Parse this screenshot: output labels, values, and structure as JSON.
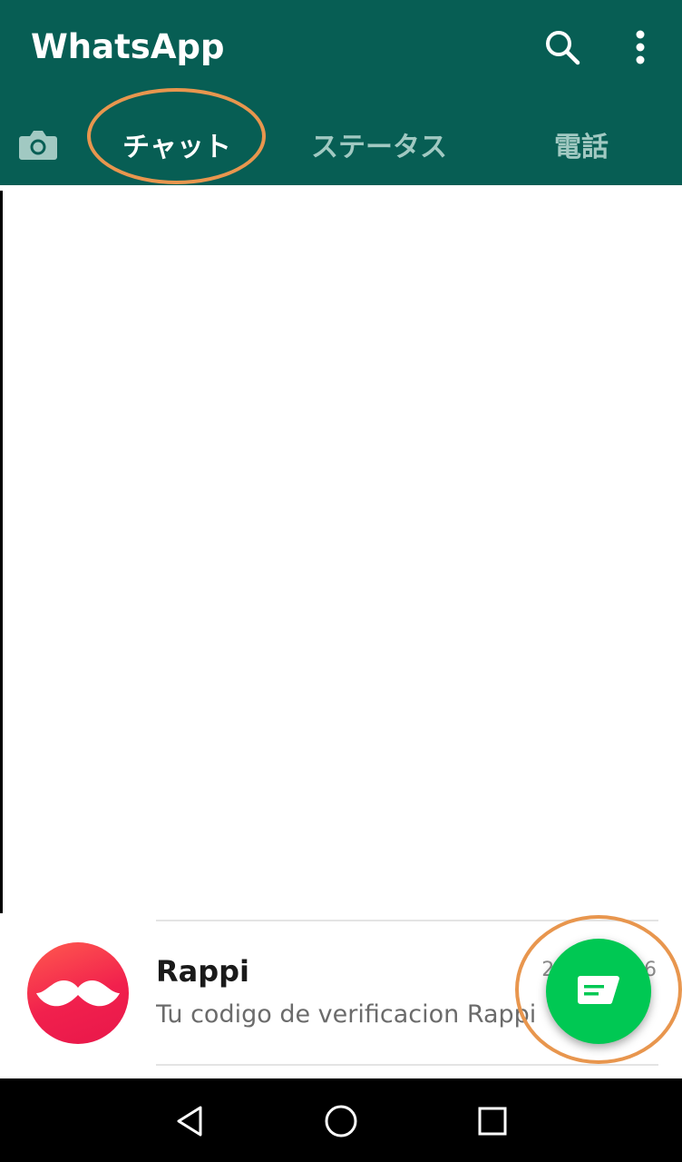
{
  "app_bar": {
    "title": "WhatsApp",
    "background_color": "#075e54",
    "search_icon": "search-icon",
    "more_icon": "more-vertical-icon"
  },
  "tabs": {
    "camera_icon": "camera-icon",
    "items": [
      {
        "label": "チャット",
        "selected": true
      },
      {
        "label": "ステータス",
        "selected": false
      },
      {
        "label": "電話",
        "selected": false
      }
    ],
    "selected_color": "#ffffff",
    "unselected_color": "#a1c9c2"
  },
  "chat_list": {
    "items": [
      {
        "name": "Rappi",
        "preview": "Tu codigo de verificacion Rappi",
        "time": "2019/05/16",
        "avatar_icon": "mustache-icon"
      }
    ]
  },
  "fab": {
    "icon": "new-chat-icon",
    "color": "#00c853"
  },
  "annotation": {
    "ring_color": "#e8964e"
  },
  "nav_bar": {
    "back_icon": "back-triangle-icon",
    "home_icon": "home-circle-icon",
    "recent_icon": "recent-square-icon"
  }
}
